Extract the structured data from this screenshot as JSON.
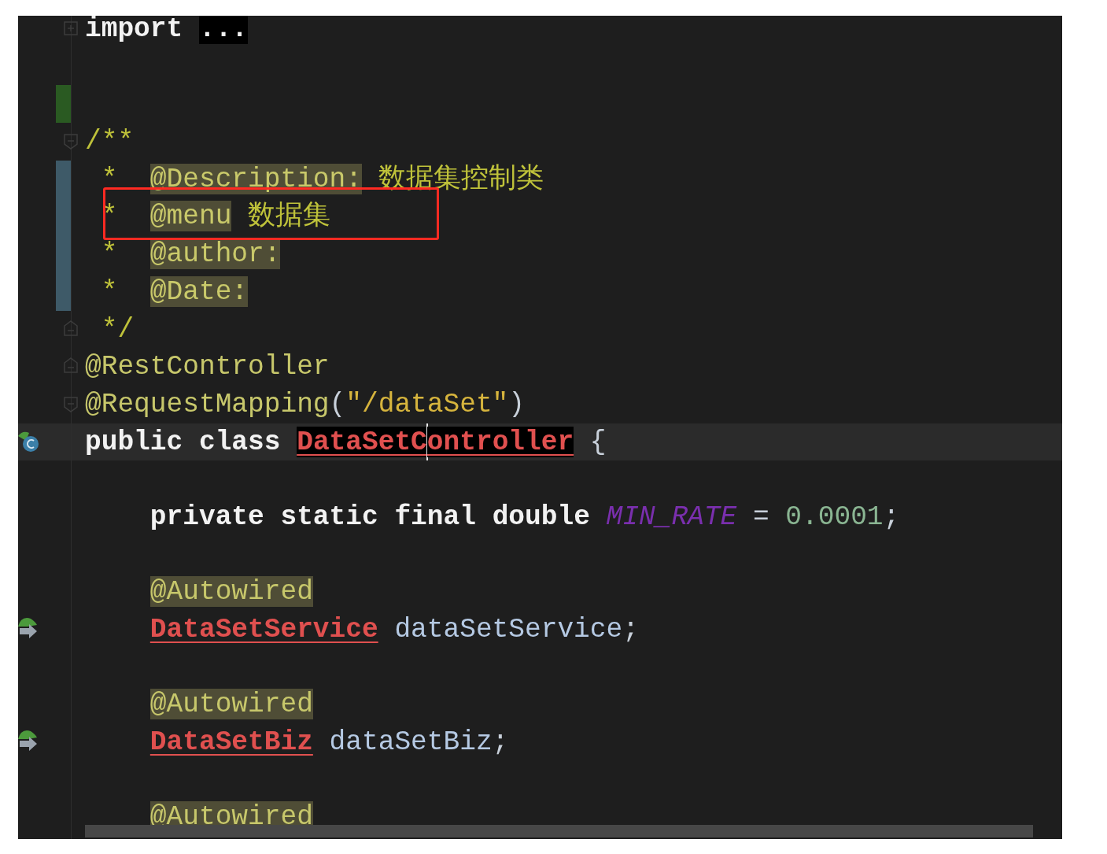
{
  "editor": {
    "lines": [
      {
        "kind": "code",
        "gutter": [
          {
            "kind": "fold_collapsed"
          }
        ],
        "tokens": [
          {
            "kind": "keyword",
            "text": "import"
          },
          {
            "kind": "folded",
            "text": "..."
          }
        ]
      },
      {
        "kind": "blank"
      },
      {
        "kind": "blank",
        "change": {
          "kind": "added"
        }
      },
      {
        "kind": "code",
        "gutter": [
          {
            "kind": "fold_start"
          }
        ],
        "tokens": [
          {
            "kind": "comment",
            "text": "/**"
          }
        ]
      },
      {
        "kind": "doc",
        "change": {
          "kind": "modified"
        },
        "tokens": [
          {
            "kind": "comment",
            "text": "*"
          },
          {
            "kind": "doc_tag",
            "text": "@Description:"
          },
          {
            "kind": "comment",
            "text": "数据集控制类"
          }
        ]
      },
      {
        "kind": "doc",
        "change": {
          "kind": "modified"
        },
        "tokens": [
          {
            "kind": "comment",
            "text": "*"
          },
          {
            "kind": "doc_tag",
            "text": "@menu"
          },
          {
            "kind": "comment",
            "text": "数据集"
          }
        ]
      },
      {
        "kind": "doc",
        "change": {
          "kind": "modified"
        },
        "tokens": [
          {
            "kind": "comment",
            "text": "*"
          },
          {
            "kind": "doc_tag",
            "text": "@author:"
          }
        ]
      },
      {
        "kind": "doc",
        "change": {
          "kind": "modified"
        },
        "tokens": [
          {
            "kind": "comment",
            "text": "*"
          },
          {
            "kind": "doc_tag",
            "text": "@Date:"
          }
        ]
      },
      {
        "kind": "doc",
        "gutter": [
          {
            "kind": "fold_end"
          }
        ],
        "tokens": [
          {
            "kind": "comment",
            "text": "*/"
          }
        ]
      },
      {
        "kind": "code",
        "gutter": [
          {
            "kind": "fold_end"
          }
        ],
        "tokens": [
          {
            "kind": "annotation",
            "text": "@RestController"
          }
        ]
      },
      {
        "kind": "code",
        "gutter": [
          {
            "kind": "fold_start"
          }
        ],
        "tokens": [
          {
            "kind": "annotation",
            "text": "@RequestMapping"
          },
          {
            "kind": "plain",
            "text": "(",
            "joined": true
          },
          {
            "kind": "string",
            "text": "\"/dataSet\"",
            "joined": true
          },
          {
            "kind": "plain",
            "text": ")",
            "joined": true
          }
        ]
      },
      {
        "kind": "code",
        "current": true,
        "gutter": [
          {
            "kind": "class"
          }
        ],
        "tokens": [
          {
            "kind": "keyword",
            "text": "public"
          },
          {
            "kind": "keyword",
            "text": "class"
          },
          {
            "kind": "unresolved",
            "text": "DataSetC",
            "caret_after": true,
            "selected": true
          },
          {
            "kind": "unresolved",
            "text": "ontroller",
            "joined": true,
            "caret_after": false,
            "selected": true
          },
          {
            "kind": "plain",
            "text": "{"
          }
        ]
      },
      {
        "kind": "blank"
      },
      {
        "kind": "member",
        "tokens": [
          {
            "kind": "keyword",
            "text": "private"
          },
          {
            "kind": "keyword",
            "text": "static"
          },
          {
            "kind": "keyword",
            "text": "final"
          },
          {
            "kind": "keyword",
            "text": "double"
          },
          {
            "kind": "constant",
            "text": "MIN_RATE"
          },
          {
            "kind": "plain",
            "text": "="
          },
          {
            "kind": "number",
            "text": "0.0001"
          },
          {
            "kind": "plain",
            "text": ";",
            "joined": true
          }
        ]
      },
      {
        "kind": "blank"
      },
      {
        "kind": "member",
        "tokens": [
          {
            "kind": "tagged_annotation",
            "text": "@Autowired"
          }
        ]
      },
      {
        "kind": "member",
        "gutter": [
          {
            "kind": "inject"
          }
        ],
        "tokens": [
          {
            "kind": "unresolved",
            "text": "DataSetService",
            "caret_after": false,
            "selected": false
          },
          {
            "kind": "field",
            "text": "dataSetService"
          },
          {
            "kind": "plain",
            "text": ";",
            "joined": true
          }
        ]
      },
      {
        "kind": "blank"
      },
      {
        "kind": "member",
        "tokens": [
          {
            "kind": "tagged_annotation",
            "text": "@Autowired"
          }
        ]
      },
      {
        "kind": "member",
        "gutter": [
          {
            "kind": "inject"
          }
        ],
        "tokens": [
          {
            "kind": "unresolved",
            "text": "DataSetBiz",
            "caret_after": false,
            "selected": false
          },
          {
            "kind": "field",
            "text": "dataSetBiz"
          },
          {
            "kind": "plain",
            "text": ";",
            "joined": true
          }
        ]
      },
      {
        "kind": "blank"
      },
      {
        "kind": "member",
        "tokens": [
          {
            "kind": "tagged_annotation",
            "text": "@Autowired"
          }
        ]
      }
    ],
    "highlight_box": {
      "shown": true
    }
  }
}
